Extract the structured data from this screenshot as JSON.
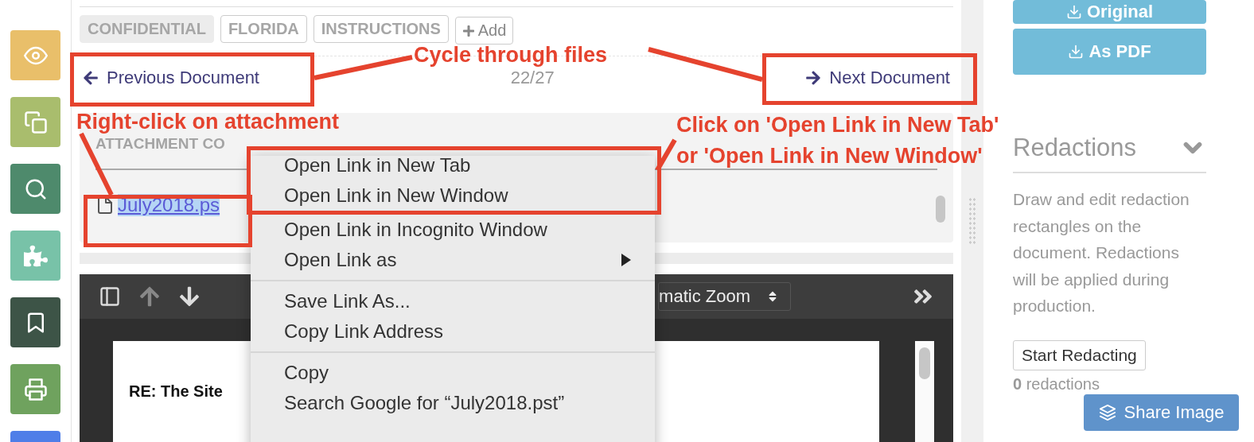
{
  "sidebar": {
    "items": [
      {
        "kind": "eye",
        "color": "#e9bf6a"
      },
      {
        "kind": "copy",
        "color": "#a9bd6d"
      },
      {
        "kind": "search",
        "color": "#4e8a6c"
      },
      {
        "kind": "puzzle",
        "color": "#78c2a8"
      },
      {
        "kind": "bookmark",
        "color": "#3d5447"
      },
      {
        "kind": "print",
        "color": "#6fa25e"
      },
      {
        "kind": "blank",
        "color": "#4f7ee8"
      }
    ]
  },
  "tags": [
    {
      "label": "CONFIDENTIAL",
      "filled": true
    },
    {
      "label": "FLORIDA",
      "filled": false
    },
    {
      "label": "INSTRUCTIONS",
      "filled": false
    }
  ],
  "add_tag": "Add",
  "navigation": {
    "previous": "Previous Document",
    "position": "22/27",
    "next": "Next Document"
  },
  "attachment": {
    "label": "ATTACHMENT CO",
    "file": "July2018.ps",
    "selected": true
  },
  "viewer": {
    "zoom": "matic Zoom",
    "page_text": "RE: The Site"
  },
  "context_menu": {
    "groups": [
      [
        {
          "label": "Open Link in New Tab",
          "submenu": false
        },
        {
          "label": "Open Link in New Window",
          "submenu": false
        },
        {
          "label": "Open Link in Incognito Window",
          "submenu": false
        },
        {
          "label": "Open Link as",
          "submenu": true
        }
      ],
      [
        {
          "label": "Save Link As...",
          "submenu": false
        },
        {
          "label": "Copy Link Address",
          "submenu": false
        }
      ],
      [
        {
          "label": "Copy",
          "submenu": false
        },
        {
          "label": "Search Google for “July2018.pst”",
          "submenu": false
        }
      ]
    ]
  },
  "download": {
    "buttons": [
      "Original",
      "As PDF"
    ]
  },
  "redactions": {
    "title": "Redactions",
    "expanded": false,
    "description": "Draw and edit redaction rectangles on the document. Redactions will be applied during production.",
    "action": "Start Redacting",
    "count": "**0** redactions"
  },
  "share": "Share Image",
  "annotations": {
    "cycle": "Cycle through files",
    "right_click": "Right-click on attachment",
    "click_on": [
      "Click on 'Open Link in New Tab'",
      "or 'Open Link in New Window'"
    ]
  }
}
